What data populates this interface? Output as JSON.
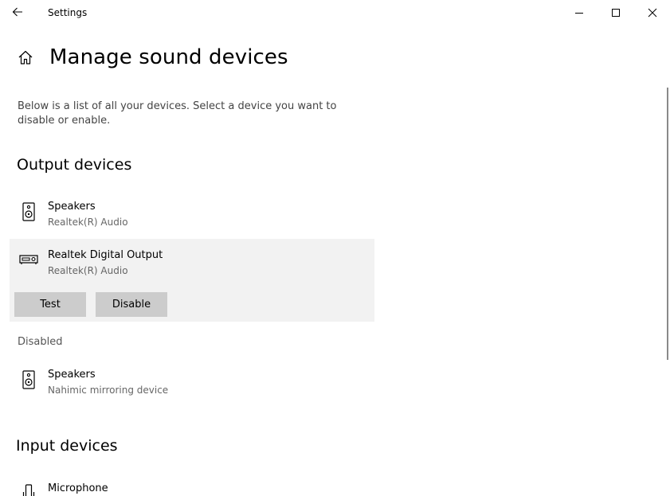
{
  "window": {
    "title": "Settings",
    "controls": {
      "back": "back-arrow-icon",
      "minimize": "minimize-icon",
      "maximize": "maximize-icon",
      "close": "close-icon"
    }
  },
  "header": {
    "home_icon": "home-icon",
    "title": "Manage sound devices"
  },
  "description": "Below is a list of all your devices. Select a device you want to disable or enable.",
  "output": {
    "title": "Output devices",
    "devices": [
      {
        "name": "Speakers",
        "sub": "Realtek(R) Audio",
        "icon": "speaker-icon"
      },
      {
        "name": "Realtek Digital Output",
        "sub": "Realtek(R) Audio",
        "icon": "digital-output-icon",
        "selected": true,
        "buttons": {
          "test": "Test",
          "disable": "Disable"
        }
      }
    ],
    "disabled_label": "Disabled",
    "disabled_devices": [
      {
        "name": "Speakers",
        "sub": "Nahimic mirroring device",
        "icon": "speaker-icon"
      }
    ]
  },
  "input": {
    "title": "Input devices",
    "devices": [
      {
        "name": "Microphone",
        "icon": "microphone-icon"
      }
    ]
  },
  "colors": {
    "selected_bg": "#f2f2f2",
    "button_bg": "#cccccc",
    "secondary_text": "#666666"
  }
}
